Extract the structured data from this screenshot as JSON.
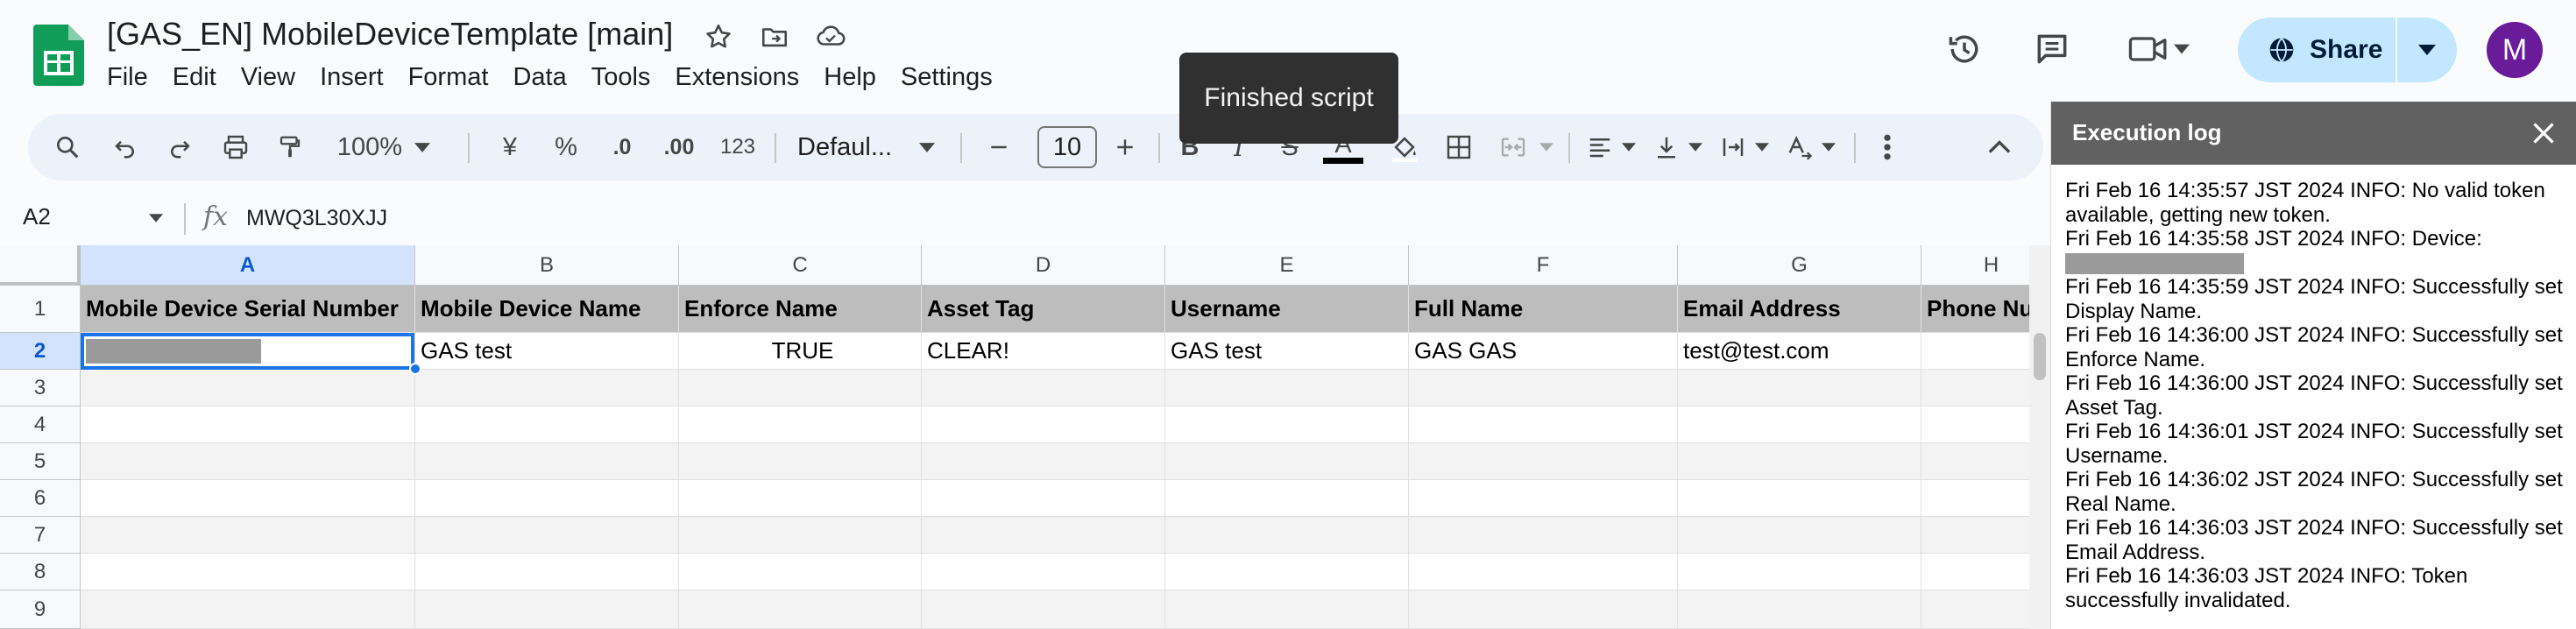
{
  "document": {
    "title": "[GAS_EN] MobileDeviceTemplate [main]"
  },
  "menu": [
    "File",
    "Edit",
    "View",
    "Insert",
    "Format",
    "Data",
    "Tools",
    "Extensions",
    "Help",
    "Settings"
  ],
  "header": {
    "share_label": "Share",
    "avatar_initial": "M"
  },
  "toolbar": {
    "zoom": "100%",
    "currency": "¥",
    "percent": "%",
    "decrease_decimal": ".0",
    "increase_decimal": ".00",
    "number_format": "123",
    "font": "Defaul...",
    "font_size": "10",
    "bold": "B",
    "italic": "I",
    "strikethrough": "S",
    "text_color": "A"
  },
  "tooltip": "Finished script",
  "formula_bar": {
    "cell_ref": "A2",
    "fx": "fx",
    "value": "MWQ3L30XJJ"
  },
  "grid": {
    "columns": [
      "A",
      "B",
      "C",
      "D",
      "E",
      "F",
      "G",
      "H"
    ],
    "selected_column": "A",
    "rows": [
      "1",
      "2",
      "3",
      "4",
      "5",
      "6",
      "7",
      "8",
      "9"
    ],
    "selected_row": "2",
    "header_row": [
      "Mobile Device Serial Number",
      "Mobile Device Name",
      "Enforce Name",
      "Asset Tag",
      "Username",
      "Full Name",
      "Email Address",
      "Phone Nu"
    ],
    "data_row": [
      "",
      "GAS test",
      "TRUE",
      "CLEAR!",
      "GAS test",
      "GAS GAS",
      "test@test.com",
      ""
    ]
  },
  "panel": {
    "title": "Execution log",
    "log": [
      "Fri Feb 16 14:35:57 JST 2024 INFO: No valid token available, getting new token.",
      "Fri Feb 16 14:35:58 JST 2024 INFO: Device:",
      "Fri Feb 16 14:35:59 JST 2024 INFO: Successfully set Display Name.",
      "Fri Feb 16 14:36:00 JST 2024 INFO: Successfully set Enforce Name.",
      "Fri Feb 16 14:36:00 JST 2024 INFO: Successfully set Asset Tag.",
      "Fri Feb 16 14:36:01 JST 2024 INFO: Successfully set Username.",
      "Fri Feb 16 14:36:02 JST 2024 INFO: Successfully set Real Name.",
      "Fri Feb 16 14:36:03 JST 2024 INFO: Successfully set Email Address.",
      "Fri Feb 16 14:36:03 JST 2024 INFO: Token successfully invalidated."
    ]
  },
  "colors": {
    "sheets_green": "#0f9d58",
    "selection_blue": "#1a73e8",
    "share_bg": "#c2e7ff",
    "panel_header": "#616161",
    "avatar": "#6a1b9a"
  }
}
